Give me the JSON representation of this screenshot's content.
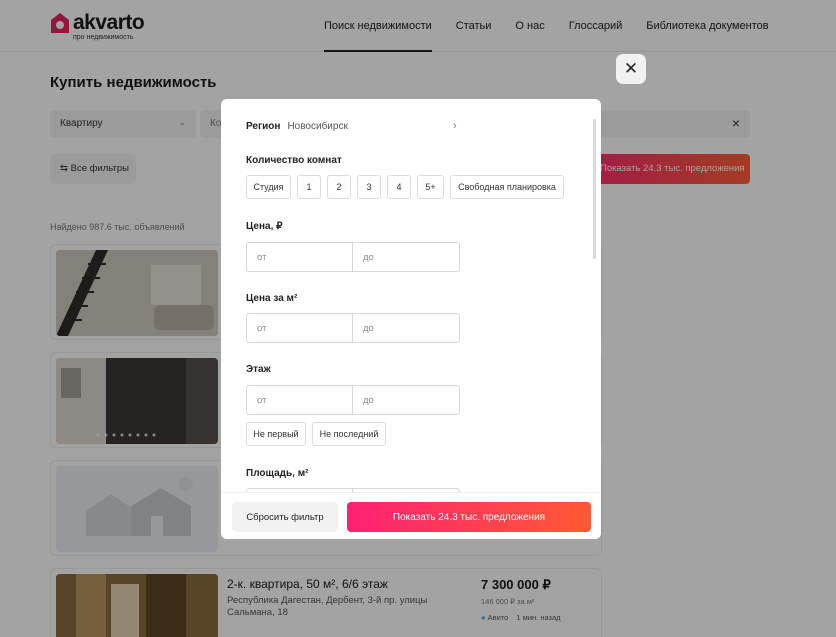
{
  "header": {
    "logo_name": "akvarto",
    "logo_sub": "про недвижимость",
    "nav": [
      {
        "label": "Поиск недвижимости",
        "active": true
      },
      {
        "label": "Статьи"
      },
      {
        "label": "О нас"
      },
      {
        "label": "Глоссарий"
      },
      {
        "label": "Библиотека документов"
      }
    ]
  },
  "page": {
    "title": "Купить недвижимость",
    "type_select": "Квартиру",
    "search_prefix": "Ко",
    "all_filters": "Все фильтры",
    "show_offers": "Показать 24.3 тыс. предложения",
    "found": "Найдено 987.6 тыс. объявлений"
  },
  "listing": {
    "title": "2-к. квартира, 50 м², 6/6 этаж",
    "address": "Республика Дагестан, Дербент, 3-й пр. улицы Сальмана, 18",
    "price": "7 300 000 ₽",
    "price_per_m2": "146 000 ₽ за м²",
    "source": "Авито",
    "age": "1 мин. назад"
  },
  "modal": {
    "region_label": "Регион",
    "region_value": "Новосибирск",
    "rooms_title": "Количество комнат",
    "rooms": [
      "Студия",
      "1",
      "2",
      "3",
      "4",
      "5+",
      "Свободная планировка"
    ],
    "price_title": "Цена, ₽",
    "price_per_m2_title": "Цена за м²",
    "floor_title": "Этаж",
    "area_title": "Площадь, м²",
    "from_placeholder": "от",
    "to_placeholder": "до",
    "floor_options": [
      "Не первый",
      "Не последний"
    ],
    "reset_label": "Сбросить фильтр",
    "apply_label": "Показать 24.3 тыс. предложения"
  },
  "colors": {
    "accent_start": "#ff1f73",
    "accent_end": "#ff5a34",
    "logo_mark": "#e6245e"
  }
}
